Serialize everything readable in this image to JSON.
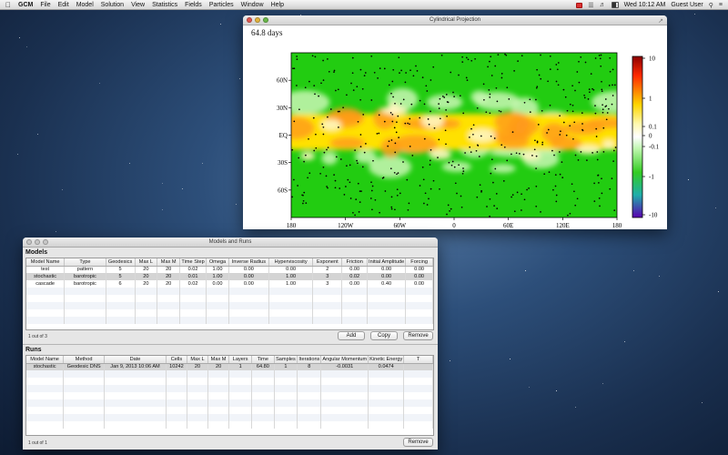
{
  "menubar": {
    "app_name": "GCM",
    "items": [
      "File",
      "Edit",
      "Model",
      "Solution",
      "View",
      "Statistics",
      "Fields",
      "Particles",
      "Window",
      "Help"
    ],
    "clock": "Wed 10:12 AM",
    "user": "Guest User"
  },
  "projection_window": {
    "title": "Cylindrical Projection",
    "time_label": "64.8 days",
    "lat_labels": [
      "60N",
      "30N",
      "EQ",
      "30S",
      "60S"
    ],
    "lon_labels": [
      "180",
      "120W",
      "60W",
      "0",
      "60E",
      "120E",
      "180"
    ],
    "colorbar_labels": [
      "10",
      "1",
      "0.1",
      "0",
      "-0.1",
      "-1",
      "-10"
    ],
    "colors": {
      "high": "#e00000",
      "mid_high": "#ffe100",
      "zero": "#ffffff",
      "mid_low": "#22cc11",
      "low": "#2d2dd8"
    }
  },
  "models_window": {
    "title": "Models and Runs",
    "models_label": "Models",
    "models_columns": [
      "Model Name",
      "Type",
      "Geodesics",
      "Max L",
      "Max M",
      "Time Step",
      "Omega",
      "Inverse Radius",
      "Hyperviscosity",
      "Exponent",
      "Friction",
      "Initial Amplitude",
      "Forcing"
    ],
    "models_rows": [
      [
        "test",
        "pattern",
        "5",
        "20",
        "20",
        "0.02",
        "1.00",
        "0.00",
        "0.00",
        "2",
        "0.00",
        "0.00",
        "0.00"
      ],
      [
        "stochastic",
        "barotropic",
        "5",
        "20",
        "20",
        "0.01",
        "1.00",
        "0.00",
        "1.00",
        "3",
        "0.02",
        "0.00",
        "0.00"
      ],
      [
        "cascade",
        "barotropic",
        "6",
        "20",
        "20",
        "0.02",
        "0.00",
        "0.00",
        "1.00",
        "3",
        "0.00",
        "0.40",
        "0.00"
      ]
    ],
    "models_row_count": "1 out of 3",
    "buttons": {
      "add": "Add",
      "copy": "Copy",
      "remove": "Remove",
      "runs_remove": "Remove"
    },
    "runs_label": "Runs",
    "runs_columns": [
      "Model Name",
      "Method",
      "Date",
      "Cells",
      "Max L",
      "Max M",
      "Layers",
      "Time",
      "Samples",
      "Iterations",
      "Angular Momentum",
      "Kinetic Energy",
      "T"
    ],
    "runs_rows": [
      [
        "stochastic",
        "Geodesic DNS",
        "Jan 9, 2013 10:06 AM",
        "10242",
        "20",
        "20",
        "1",
        "64.80",
        "1",
        "8",
        "-0.0031",
        "0.0474",
        ""
      ]
    ],
    "runs_row_count": "1 out of 1"
  }
}
